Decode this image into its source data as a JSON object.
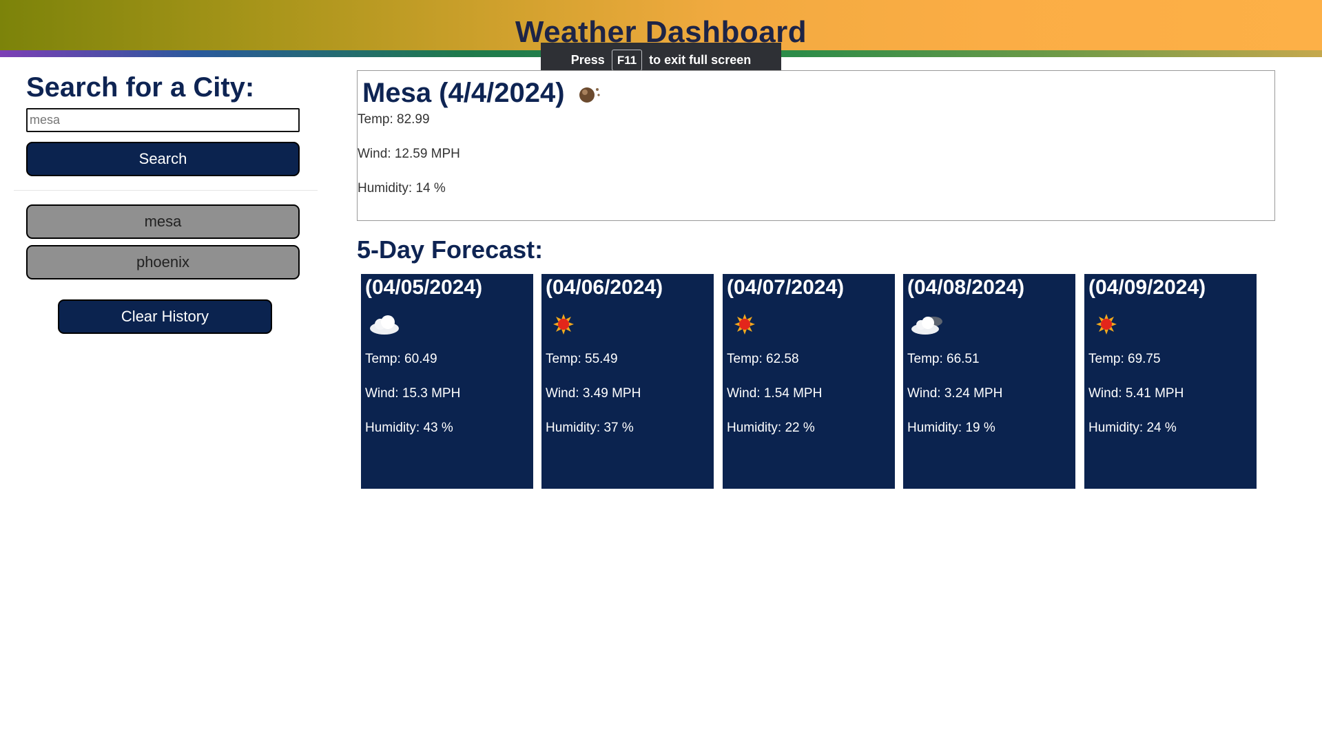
{
  "header": {
    "title": "Weather Dashboard",
    "fullscreen_notice": {
      "press": "Press",
      "key": "F11",
      "rest": "to exit full screen"
    }
  },
  "sidebar": {
    "heading": "Search for a City:",
    "search_placeholder": "mesa",
    "search_label": "Search",
    "history": [
      "mesa",
      "phoenix"
    ],
    "clear_label": "Clear History"
  },
  "current": {
    "title": "Mesa (4/4/2024)",
    "icon": "dust-icon",
    "temp": "Temp: 82.99",
    "wind": "Wind: 12.59 MPH",
    "humidity": "Humidity: 14 %"
  },
  "forecast": {
    "heading": "5-Day Forecast:",
    "days": [
      {
        "date": "(04/05/2024)",
        "icon": "cloud-icon",
        "temp": "Temp: 60.49",
        "wind": "Wind: 15.3 MPH",
        "humidity": "Humidity: 43 %"
      },
      {
        "date": "(04/06/2024)",
        "icon": "sun-icon",
        "temp": "Temp: 55.49",
        "wind": "Wind: 3.49 MPH",
        "humidity": "Humidity: 37 %"
      },
      {
        "date": "(04/07/2024)",
        "icon": "sun-icon",
        "temp": "Temp: 62.58",
        "wind": "Wind: 1.54 MPH",
        "humidity": "Humidity: 22 %"
      },
      {
        "date": "(04/08/2024)",
        "icon": "night-cloud-icon",
        "temp": "Temp: 66.51",
        "wind": "Wind: 3.24 MPH",
        "humidity": "Humidity: 19 %"
      },
      {
        "date": "(04/09/2024)",
        "icon": "sun-icon",
        "temp": "Temp: 69.75",
        "wind": "Wind: 5.41 MPH",
        "humidity": "Humidity: 24 %"
      }
    ]
  },
  "colors": {
    "navy": "#0b234f",
    "heading": "#0e2453",
    "history_button": "#909090"
  }
}
